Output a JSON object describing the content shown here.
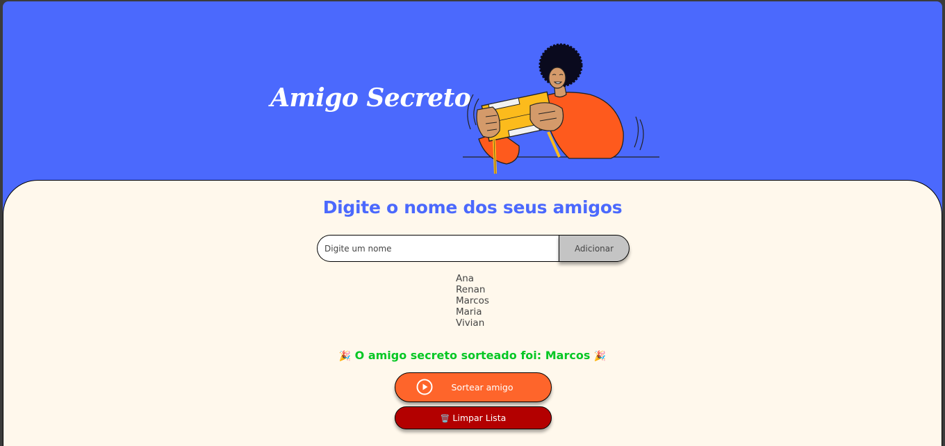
{
  "header": {
    "title": "Amigo Secreto"
  },
  "main": {
    "section_title": "Digite o nome dos seus amigos",
    "input_placeholder": "Digite um nome",
    "input_value": "",
    "add_button_label": "Adicionar",
    "friends": [
      "Ana",
      "Renan",
      "Marcos",
      "Maria",
      "Vivian"
    ],
    "result": {
      "prefix": "O amigo secreto sorteado foi:",
      "name": "Marcos",
      "emoji_left": "🎉",
      "emoji_right": "🎉"
    },
    "draw_button_label": "Sortear amigo",
    "clear_button_label": "Limpar Lista",
    "clear_button_icon": "🗑️"
  },
  "colors": {
    "header_bg": "#4b69fd",
    "panel_bg": "#fff8ec",
    "title_blue": "#4b69fd",
    "result_green": "#05c724",
    "draw_orange": "#fe652b",
    "clear_red": "#b30000",
    "add_gray": "#c4c4c4"
  },
  "icons": {
    "draw_button_icon": "play-circle-icon",
    "clear_button_icon": "trash-icon",
    "illustration": "person-holding-gift-illustration"
  }
}
